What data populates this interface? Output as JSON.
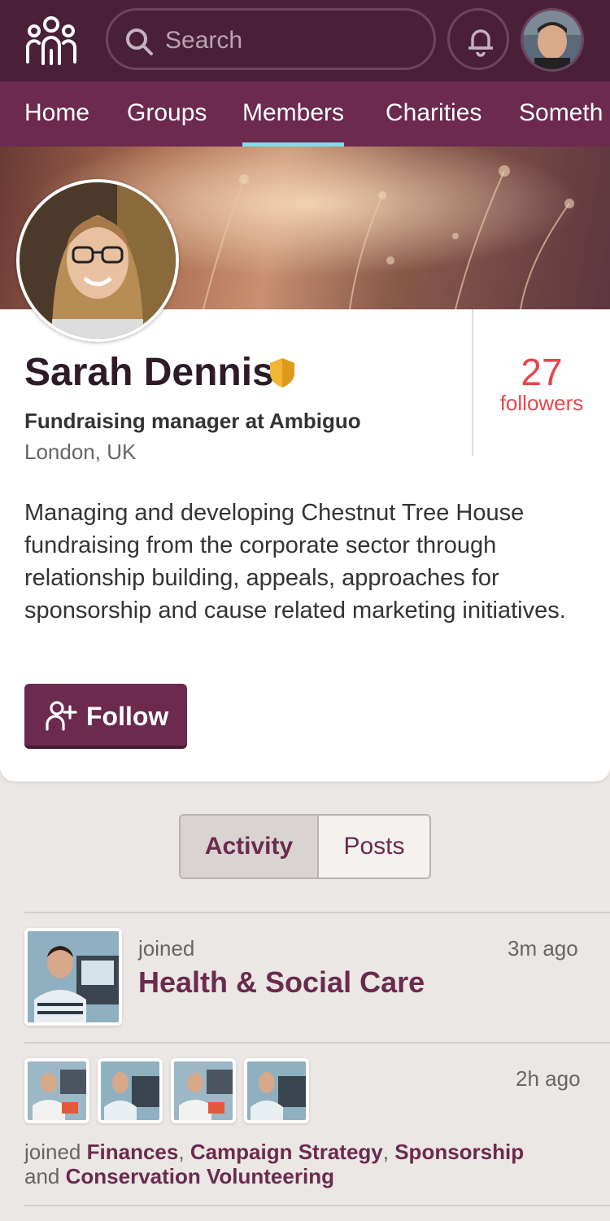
{
  "header": {
    "search_placeholder": "Search"
  },
  "nav": {
    "items": [
      "Home",
      "Groups",
      "Members",
      "Charities",
      "Someth"
    ],
    "active": "Members"
  },
  "profile": {
    "name": "Sarah Dennis",
    "job_title": "Fundraising manager at Ambiguo",
    "location": "London, UK",
    "followers_count": "27",
    "followers_label": "followers",
    "bio": "Managing and developing Chestnut Tree House fundraising from the corporate sector through relationship building, appeals, approaches for sponsorship and cause related marketing initiatives.",
    "follow_label": "Follow"
  },
  "tabs": {
    "activity": "Activity",
    "posts": "Posts",
    "active": "Activity"
  },
  "feed": [
    {
      "verb": "joined",
      "group": "Health & Social Care",
      "time": "3m ago"
    },
    {
      "time": "2h ago",
      "verb": "joined",
      "groups": [
        "Finances",
        "Campaign Strategy",
        "Sponsorship"
      ],
      "and": "and",
      "last_group": "Conservation Volunteering"
    }
  ],
  "colors": {
    "topbar": "#4a1f38",
    "nav": "#6b2a4e",
    "nav_active_underline": "#7fdde8",
    "brand": "#6b2a4e",
    "followers": "#e8454a",
    "verified_shield": "#f2b632"
  },
  "icons": {
    "logo": "people-group-icon",
    "search": "search-icon",
    "notifications": "bell-icon",
    "verified": "shield-icon",
    "follow": "add-user-icon"
  }
}
